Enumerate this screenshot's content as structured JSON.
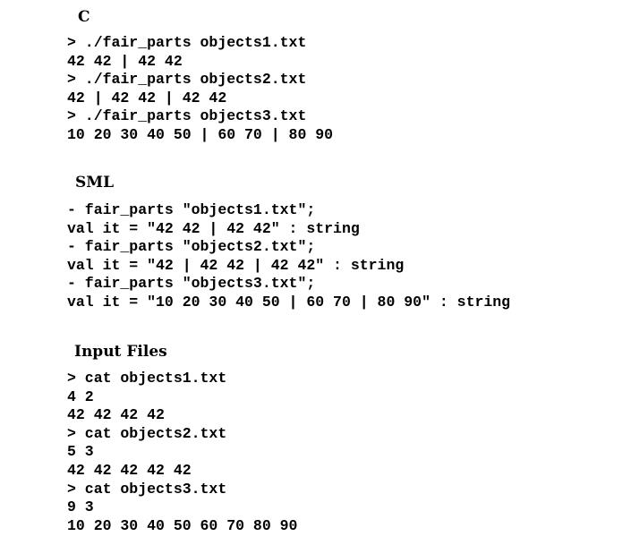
{
  "sections": [
    {
      "heading": "C",
      "lines": [
        "> ./fair_parts objects1.txt",
        "42 42 | 42 42",
        "> ./fair_parts objects2.txt",
        "42 | 42 42 | 42 42",
        "> ./fair_parts objects3.txt",
        "10 20 30 40 50 | 60 70 | 80 90"
      ]
    },
    {
      "heading": "SML",
      "lines": [
        "- fair_parts \"objects1.txt\";",
        "val it = \"42 42 | 42 42\" : string",
        "- fair_parts \"objects2.txt\";",
        "val it = \"42 | 42 42 | 42 42\" : string",
        "- fair_parts \"objects3.txt\";",
        "val it = \"10 20 30 40 50 | 60 70 | 80 90\" : string"
      ]
    },
    {
      "heading": "Input Files",
      "lines": [
        "> cat objects1.txt",
        "4 2",
        "42 42 42 42",
        "> cat objects2.txt",
        "5 3",
        "42 42 42 42 42",
        "> cat objects3.txt",
        "9 3",
        "10 20 30 40 50 60 70 80 90"
      ]
    }
  ]
}
